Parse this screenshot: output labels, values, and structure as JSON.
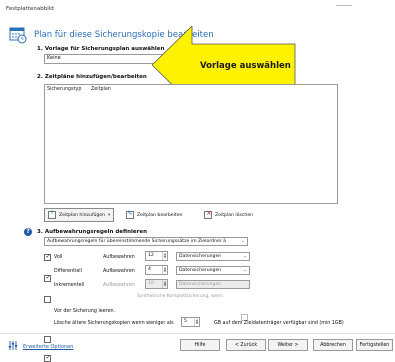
{
  "window": {
    "title": "Festplattenabbild"
  },
  "wizard": {
    "title": "Plan für diese Sicherungskopie bearbeiten"
  },
  "section1": {
    "heading": "1. Vorlage für Sicherungsplan auswählen",
    "value": "Keine"
  },
  "callout": {
    "text": "Vorlage auswählen",
    "color": "#fff200"
  },
  "section2": {
    "heading": "2. Zeitpläne hinzufügen/bearbeiten",
    "columns": [
      "Sicherungstyp",
      "Zeitplan"
    ],
    "add_label": "Zeitplan hinzufügen",
    "edit_label": "Zeitplan bearbeiten",
    "delete_label": "Zeitplan löschen"
  },
  "section3": {
    "heading": "3. Aufbewahrungsregeln definieren",
    "rule_select": "Aufbewahrungsregeln für übereinstimmende Sicherungssätze im Zielordner ä",
    "rows": [
      {
        "label": "Voll",
        "checked": true,
        "keep_label": "Aufbewahren",
        "count": "12",
        "unit": "Datensicherungen",
        "disabled": false
      },
      {
        "label": "Differentiell",
        "checked": true,
        "keep_label": "Aufbewahren",
        "count": "4",
        "unit": "Datensicherungen",
        "disabled": false
      },
      {
        "label": "Inkrementell",
        "checked": false,
        "keep_label": "Aufbewahren",
        "count": "10",
        "unit": "Datensicherungen",
        "disabled": true
      }
    ],
    "synthetic_label": "Synthetische Komplettsicherung, wenn"
  },
  "options": {
    "purge_before": "Vor der Sicherung leeren.",
    "purge_old_prefix": "Lösche ältere Sicherungskopien wenn weniger als",
    "purge_old_value": "5",
    "purge_old_suffix": "GB auf dem Zieldatenträger verfügbar sind (min 1GB)"
  },
  "footer": {
    "advanced_link": "Erweiterte Optionen",
    "help": "Hilfe",
    "back": "< Zurück",
    "next": "Weiter >",
    "cancel": "Abbrechen",
    "finish": "Fertigstellen"
  },
  "colors": {
    "accent": "#2a6fb8",
    "help_icon": "#1e5aa8"
  }
}
